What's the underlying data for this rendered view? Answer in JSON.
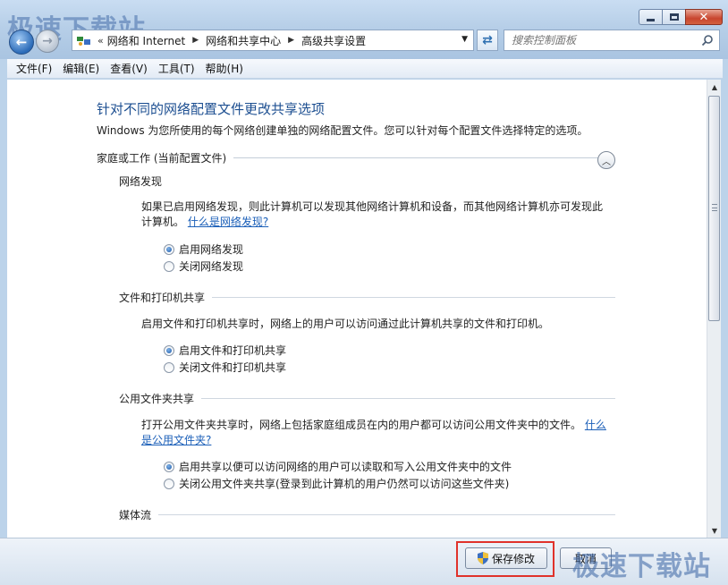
{
  "watermark": "极速下载站",
  "window": {
    "minimize_icon": "minimize-icon",
    "maximize_icon": "maximize-icon",
    "close_icon": "close-icon"
  },
  "address": {
    "lead": "«",
    "crumbs": [
      "网络和 Internet",
      "网络和共享中心",
      "高级共享设置"
    ]
  },
  "search": {
    "placeholder": "搜索控制面板"
  },
  "menu": [
    "文件(F)",
    "编辑(E)",
    "查看(V)",
    "工具(T)",
    "帮助(H)"
  ],
  "page": {
    "title": "针对不同的网络配置文件更改共享选项",
    "intro": "Windows 为您所使用的每个网络创建单独的网络配置文件。您可以针对每个配置文件选择特定的选项。",
    "profile_label": "家庭或工作 (当前配置文件)"
  },
  "sections": {
    "discovery": {
      "title": "网络发现",
      "desc": "如果已启用网络发现，则此计算机可以发现其他网络计算机和设备，而其他网络计算机亦可发现此计算机。",
      "link": "什么是网络发现?",
      "options": [
        "启用网络发现",
        "关闭网络发现"
      ],
      "selected": 0
    },
    "file_print": {
      "title": "文件和打印机共享",
      "desc": "启用文件和打印机共享时，网络上的用户可以访问通过此计算机共享的文件和打印机。",
      "options": [
        "启用文件和打印机共享",
        "关闭文件和打印机共享"
      ],
      "selected": 0
    },
    "public_folder": {
      "title": "公用文件夹共享",
      "desc": "打开公用文件夹共享时，网络上包括家庭组成员在内的用户都可以访问公用文件夹中的文件。",
      "link": "什么是公用文件夹?",
      "options": [
        "启用共享以便可以访问网络的用户可以读取和写入公用文件夹中的文件",
        "关闭公用文件夹共享(登录到此计算机的用户仍然可以访问这些文件夹)"
      ],
      "selected": 0
    },
    "media": {
      "title": "媒体流"
    }
  },
  "buttons": {
    "save": "保存修改",
    "cancel": "取消"
  },
  "colors": {
    "highlight": "#e0322b",
    "link": "#1b5fb8",
    "title": "#1d4f91"
  }
}
